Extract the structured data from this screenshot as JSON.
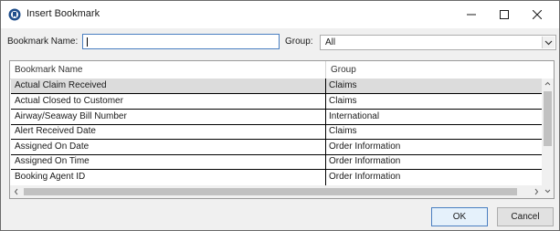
{
  "window": {
    "title": "Insert Bookmark"
  },
  "form": {
    "name_label": "Bookmark Name:",
    "name_value": "",
    "group_label": "Group:",
    "group_value": "All"
  },
  "grid": {
    "columns": [
      "Bookmark Name",
      "Group"
    ],
    "rows": [
      {
        "name": "Actual Claim Received",
        "group": "Claims",
        "selected": true
      },
      {
        "name": "Actual Closed to Customer",
        "group": "Claims",
        "selected": false
      },
      {
        "name": "Airway/Seaway Bill Number",
        "group": "International",
        "selected": false
      },
      {
        "name": "Alert Received Date",
        "group": "Claims",
        "selected": false
      },
      {
        "name": "Assigned On Date",
        "group": "Order Information",
        "selected": false
      },
      {
        "name": "Assigned On Time",
        "group": "Order Information",
        "selected": false
      },
      {
        "name": "Booking Agent ID",
        "group": "Order Information",
        "selected": false
      }
    ]
  },
  "buttons": {
    "ok": "OK",
    "cancel": "Cancel"
  },
  "icons": {
    "app": "bookmark-app-icon",
    "minimize": "minimize-icon",
    "maximize": "maximize-icon",
    "close": "close-icon",
    "dropdown": "chevron-down-icon"
  }
}
